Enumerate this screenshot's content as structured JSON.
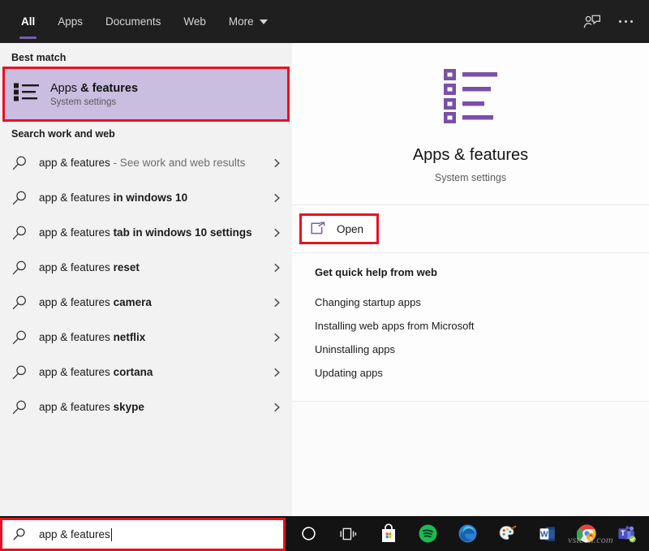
{
  "topbar": {
    "tabs": [
      {
        "label": "All",
        "active": true
      },
      {
        "label": "Apps",
        "active": false
      },
      {
        "label": "Documents",
        "active": false
      },
      {
        "label": "Web",
        "active": false
      },
      {
        "label": "More",
        "active": false,
        "has_caret": true
      }
    ],
    "feedback_icon": "person-feedback-icon",
    "overflow_icon": "more-dots-icon",
    "accent_color": "#7a5fa8",
    "background_color": "#1f1f1f"
  },
  "left_panel": {
    "best_match_header": "Best match",
    "best_match": {
      "title_prefix": "Apps ",
      "title_bold": "& features",
      "subtitle": "System settings",
      "icon": "apps-list-icon",
      "highlight_color": "#c9bde0",
      "annotation_color": "#e81123"
    },
    "search_header": "Search work and web",
    "suggestions": [
      {
        "prefix": "app & features",
        "suffix": " - See work and web results",
        "suffix_style": "muted",
        "icon": "search-icon",
        "chevron": "chevron-right-icon"
      },
      {
        "prefix": "app & features ",
        "suffix": "in windows 10",
        "suffix_style": "bold",
        "icon": "search-icon",
        "chevron": "chevron-right-icon"
      },
      {
        "prefix": "app & features ",
        "suffix": "tab in windows 10 settings",
        "suffix_style": "bold",
        "icon": "search-icon",
        "chevron": "chevron-right-icon"
      },
      {
        "prefix": "app & features ",
        "suffix": "reset",
        "suffix_style": "bold",
        "icon": "search-icon",
        "chevron": "chevron-right-icon"
      },
      {
        "prefix": "app & features ",
        "suffix": "camera",
        "suffix_style": "bold",
        "icon": "search-icon",
        "chevron": "chevron-right-icon"
      },
      {
        "prefix": "app & features ",
        "suffix": "netflix",
        "suffix_style": "bold",
        "icon": "search-icon",
        "chevron": "chevron-right-icon"
      },
      {
        "prefix": "app & features ",
        "suffix": "cortana",
        "suffix_style": "bold",
        "icon": "search-icon",
        "chevron": "chevron-right-icon"
      },
      {
        "prefix": "app & features ",
        "suffix": "skype",
        "suffix_style": "bold",
        "icon": "search-icon",
        "chevron": "chevron-right-icon"
      }
    ]
  },
  "preview": {
    "icon": "apps-list-icon-large",
    "icon_color": "#7a4fa8",
    "title": "Apps & features",
    "subtitle": "System settings",
    "open_label": "Open",
    "open_icon": "external-link-icon",
    "help_header": "Get quick help from web",
    "help_links": [
      "Changing startup apps",
      "Installing web apps from Microsoft",
      "Uninstalling apps",
      "Updating apps"
    ]
  },
  "taskbar": {
    "search_value": "app & features",
    "search_icon": "search-icon",
    "annotation_color": "#e81123",
    "items": [
      {
        "name": "cortana-icon",
        "label": "Cortana"
      },
      {
        "name": "task-view-icon",
        "label": "Task View"
      },
      {
        "name": "microsoft-store-icon",
        "label": "Microsoft Store"
      },
      {
        "name": "spotify-icon",
        "label": "Spotify"
      },
      {
        "name": "microsoft-edge-icon",
        "label": "Microsoft Edge"
      },
      {
        "name": "paint-icon",
        "label": "Paint"
      },
      {
        "name": "microsoft-word-icon",
        "label": "Word"
      },
      {
        "name": "google-chrome-icon",
        "label": "Chrome"
      },
      {
        "name": "microsoft-teams-icon",
        "label": "Teams"
      }
    ],
    "watermark": "vstech.com"
  }
}
